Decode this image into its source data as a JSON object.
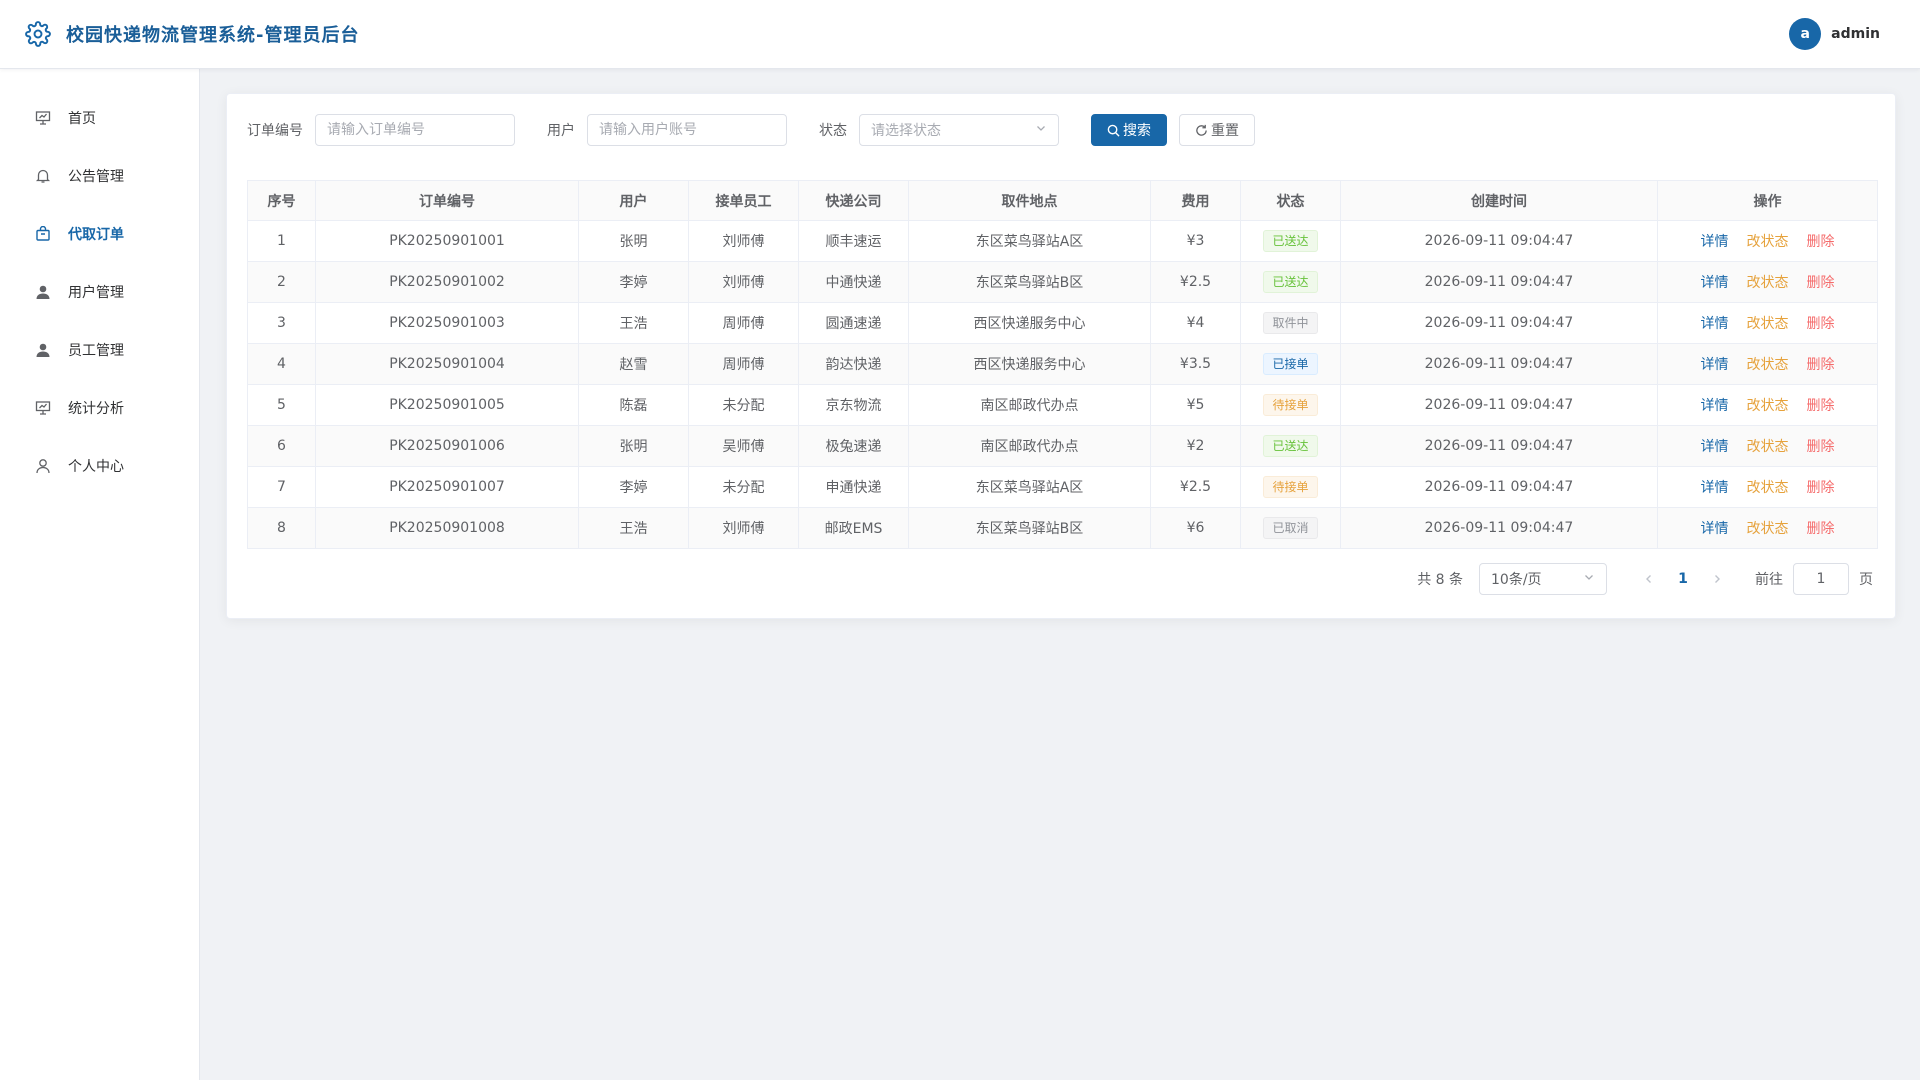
{
  "header": {
    "title": "校园快递物流管理系统-管理员后台",
    "avatar_letter": "a",
    "username": "admin",
    "logo_icon": "gear-icon"
  },
  "sidebar": {
    "items": [
      {
        "label": "首页",
        "icon": "presentation-icon",
        "active": false
      },
      {
        "label": "公告管理",
        "icon": "bell-icon",
        "active": false
      },
      {
        "label": "代取订单",
        "icon": "box-icon",
        "active": true
      },
      {
        "label": "用户管理",
        "icon": "user-icon",
        "active": false
      },
      {
        "label": "员工管理",
        "icon": "user-icon",
        "active": false
      },
      {
        "label": "统计分析",
        "icon": "presentation-icon",
        "active": false
      },
      {
        "label": "个人中心",
        "icon": "user-outline-icon",
        "active": false
      }
    ]
  },
  "search": {
    "order_label": "订单编号",
    "order_placeholder": "请输入订单编号",
    "user_label": "用户",
    "user_placeholder": "请输入用户账号",
    "status_label": "状态",
    "status_placeholder": "请选择状态",
    "search_btn": "搜索",
    "reset_btn": "重置"
  },
  "table": {
    "headers": [
      "序号",
      "订单编号",
      "用户",
      "接单员工",
      "快递公司",
      "取件地点",
      "费用",
      "状态",
      "创建时间",
      "操作"
    ],
    "actions": {
      "detail": "详情",
      "change_status": "改状态",
      "delete": "删除"
    },
    "rows": [
      {
        "no": "1",
        "order": "PK20250901001",
        "user": "张明",
        "staff": "刘师傅",
        "company": "顺丰速运",
        "location": "东区菜鸟驿站A区",
        "fee": "¥3",
        "status": "已送达",
        "status_type": "success",
        "created": "2026-09-11 09:04:47"
      },
      {
        "no": "2",
        "order": "PK20250901002",
        "user": "李婷",
        "staff": "刘师傅",
        "company": "中通快递",
        "location": "东区菜鸟驿站B区",
        "fee": "¥2.5",
        "status": "已送达",
        "status_type": "success",
        "created": "2026-09-11 09:04:47"
      },
      {
        "no": "3",
        "order": "PK20250901003",
        "user": "王浩",
        "staff": "周师傅",
        "company": "圆通速递",
        "location": "西区快递服务中心",
        "fee": "¥4",
        "status": "取件中",
        "status_type": "info",
        "created": "2026-09-11 09:04:47"
      },
      {
        "no": "4",
        "order": "PK20250901004",
        "user": "赵雪",
        "staff": "周师傅",
        "company": "韵达快递",
        "location": "西区快递服务中心",
        "fee": "¥3.5",
        "status": "已接单",
        "status_type": "primary",
        "created": "2026-09-11 09:04:47"
      },
      {
        "no": "5",
        "order": "PK20250901005",
        "user": "陈磊",
        "staff": "未分配",
        "company": "京东物流",
        "location": "南区邮政代办点",
        "fee": "¥5",
        "status": "待接单",
        "status_type": "warning",
        "created": "2026-09-11 09:04:47"
      },
      {
        "no": "6",
        "order": "PK20250901006",
        "user": "张明",
        "staff": "吴师傅",
        "company": "极兔速递",
        "location": "南区邮政代办点",
        "fee": "¥2",
        "status": "已送达",
        "status_type": "success",
        "created": "2026-09-11 09:04:47"
      },
      {
        "no": "7",
        "order": "PK20250901007",
        "user": "李婷",
        "staff": "未分配",
        "company": "申通快递",
        "location": "东区菜鸟驿站A区",
        "fee": "¥2.5",
        "status": "待接单",
        "status_type": "warning",
        "created": "2026-09-11 09:04:47"
      },
      {
        "no": "8",
        "order": "PK20250901008",
        "user": "王浩",
        "staff": "刘师傅",
        "company": "邮政EMS",
        "location": "东区菜鸟驿站B区",
        "fee": "¥6",
        "status": "已取消",
        "status_type": "info",
        "created": "2026-09-11 09:04:47"
      }
    ]
  },
  "pagination": {
    "total_text": "共 8 条",
    "page_size": "10条/页",
    "current_page": "1",
    "goto_label": "前往",
    "goto_value": "1",
    "page_suffix": "页"
  },
  "colors": {
    "primary": "#1867a8",
    "success": "#67c23a",
    "warning": "#e6a23c",
    "danger": "#f56c6c",
    "info": "#909399"
  }
}
